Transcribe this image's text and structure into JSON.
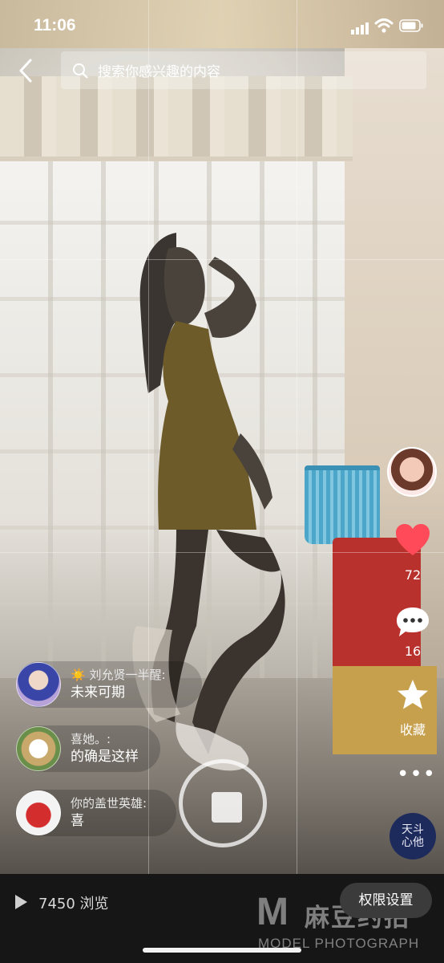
{
  "status": {
    "time": "11:06"
  },
  "search": {
    "placeholder": "搜索你感兴趣的内容"
  },
  "rail": {
    "likes": "72",
    "comments": "16",
    "favorite_label": "收藏",
    "more": "•••",
    "music_label": "天斗\n心他"
  },
  "comments": [
    {
      "user": "☀️ 刘允贤一半醒:",
      "text": "未来可期"
    },
    {
      "user": "喜她。:",
      "text": "的确是这样"
    },
    {
      "user": "你的盖世英雄:",
      "text": "喜"
    }
  ],
  "bottom": {
    "views": "7450 浏览",
    "permission_button": "权限设置"
  },
  "watermark": {
    "letter": "M",
    "chinese": "麻豆约拍",
    "english": "MODEL PHOTOGRAPH"
  },
  "colors": {
    "heart": "#ff4a5a",
    "bottom_bar": "#161616"
  }
}
